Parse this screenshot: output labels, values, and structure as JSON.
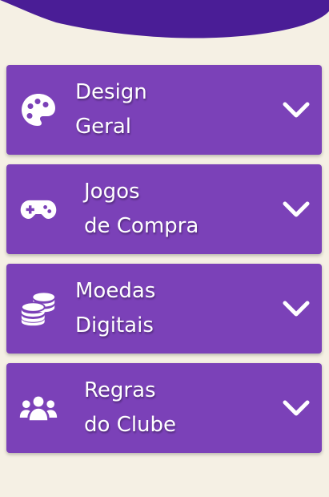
{
  "accent": "#7b41b8",
  "header_color": "#4a1d96",
  "background": "#f5f0e4",
  "accordion": {
    "items": [
      {
        "icon": "palette-icon",
        "line1": "Design",
        "line2": "Geral"
      },
      {
        "icon": "gamepad-icon",
        "line1": "Jogos",
        "line2": "de Compra"
      },
      {
        "icon": "coins-icon",
        "line1": "Moedas",
        "line2": "Digitais"
      },
      {
        "icon": "users-icon",
        "line1": "Regras",
        "line2": "do Clube"
      }
    ]
  }
}
